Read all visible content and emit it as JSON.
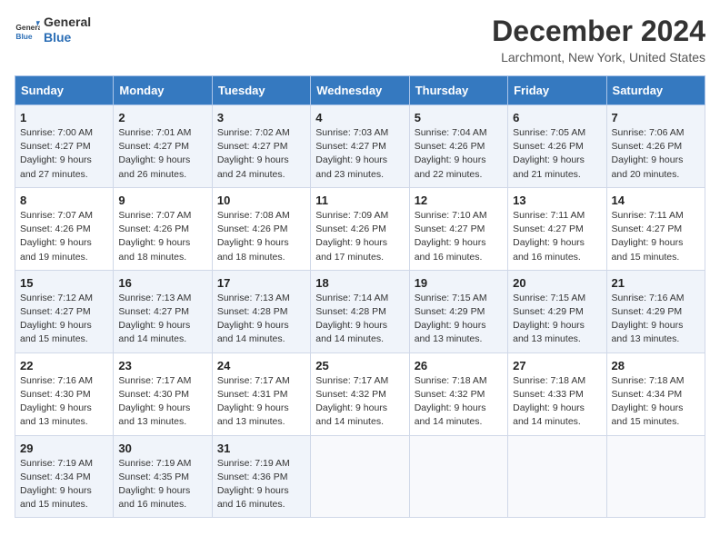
{
  "header": {
    "logo_general": "General",
    "logo_blue": "Blue",
    "title": "December 2024",
    "subtitle": "Larchmont, New York, United States"
  },
  "days_of_week": [
    "Sunday",
    "Monday",
    "Tuesday",
    "Wednesday",
    "Thursday",
    "Friday",
    "Saturday"
  ],
  "weeks": [
    [
      {
        "day": "1",
        "sunrise": "7:00 AM",
        "sunset": "4:27 PM",
        "daylight_hours": "9",
        "daylight_minutes": "27"
      },
      {
        "day": "2",
        "sunrise": "7:01 AM",
        "sunset": "4:27 PM",
        "daylight_hours": "9",
        "daylight_minutes": "26"
      },
      {
        "day": "3",
        "sunrise": "7:02 AM",
        "sunset": "4:27 PM",
        "daylight_hours": "9",
        "daylight_minutes": "24"
      },
      {
        "day": "4",
        "sunrise": "7:03 AM",
        "sunset": "4:27 PM",
        "daylight_hours": "9",
        "daylight_minutes": "23"
      },
      {
        "day": "5",
        "sunrise": "7:04 AM",
        "sunset": "4:26 PM",
        "daylight_hours": "9",
        "daylight_minutes": "22"
      },
      {
        "day": "6",
        "sunrise": "7:05 AM",
        "sunset": "4:26 PM",
        "daylight_hours": "9",
        "daylight_minutes": "21"
      },
      {
        "day": "7",
        "sunrise": "7:06 AM",
        "sunset": "4:26 PM",
        "daylight_hours": "9",
        "daylight_minutes": "20"
      }
    ],
    [
      {
        "day": "8",
        "sunrise": "7:07 AM",
        "sunset": "4:26 PM",
        "daylight_hours": "9",
        "daylight_minutes": "19"
      },
      {
        "day": "9",
        "sunrise": "7:07 AM",
        "sunset": "4:26 PM",
        "daylight_hours": "9",
        "daylight_minutes": "18"
      },
      {
        "day": "10",
        "sunrise": "7:08 AM",
        "sunset": "4:26 PM",
        "daylight_hours": "9",
        "daylight_minutes": "18"
      },
      {
        "day": "11",
        "sunrise": "7:09 AM",
        "sunset": "4:26 PM",
        "daylight_hours": "9",
        "daylight_minutes": "17"
      },
      {
        "day": "12",
        "sunrise": "7:10 AM",
        "sunset": "4:27 PM",
        "daylight_hours": "9",
        "daylight_minutes": "16"
      },
      {
        "day": "13",
        "sunrise": "7:11 AM",
        "sunset": "4:27 PM",
        "daylight_hours": "9",
        "daylight_minutes": "16"
      },
      {
        "day": "14",
        "sunrise": "7:11 AM",
        "sunset": "4:27 PM",
        "daylight_hours": "9",
        "daylight_minutes": "15"
      }
    ],
    [
      {
        "day": "15",
        "sunrise": "7:12 AM",
        "sunset": "4:27 PM",
        "daylight_hours": "9",
        "daylight_minutes": "15"
      },
      {
        "day": "16",
        "sunrise": "7:13 AM",
        "sunset": "4:27 PM",
        "daylight_hours": "9",
        "daylight_minutes": "14"
      },
      {
        "day": "17",
        "sunrise": "7:13 AM",
        "sunset": "4:28 PM",
        "daylight_hours": "9",
        "daylight_minutes": "14"
      },
      {
        "day": "18",
        "sunrise": "7:14 AM",
        "sunset": "4:28 PM",
        "daylight_hours": "9",
        "daylight_minutes": "14"
      },
      {
        "day": "19",
        "sunrise": "7:15 AM",
        "sunset": "4:29 PM",
        "daylight_hours": "9",
        "daylight_minutes": "13"
      },
      {
        "day": "20",
        "sunrise": "7:15 AM",
        "sunset": "4:29 PM",
        "daylight_hours": "9",
        "daylight_minutes": "13"
      },
      {
        "day": "21",
        "sunrise": "7:16 AM",
        "sunset": "4:29 PM",
        "daylight_hours": "9",
        "daylight_minutes": "13"
      }
    ],
    [
      {
        "day": "22",
        "sunrise": "7:16 AM",
        "sunset": "4:30 PM",
        "daylight_hours": "9",
        "daylight_minutes": "13"
      },
      {
        "day": "23",
        "sunrise": "7:17 AM",
        "sunset": "4:30 PM",
        "daylight_hours": "9",
        "daylight_minutes": "13"
      },
      {
        "day": "24",
        "sunrise": "7:17 AM",
        "sunset": "4:31 PM",
        "daylight_hours": "9",
        "daylight_minutes": "13"
      },
      {
        "day": "25",
        "sunrise": "7:17 AM",
        "sunset": "4:32 PM",
        "daylight_hours": "9",
        "daylight_minutes": "14"
      },
      {
        "day": "26",
        "sunrise": "7:18 AM",
        "sunset": "4:32 PM",
        "daylight_hours": "9",
        "daylight_minutes": "14"
      },
      {
        "day": "27",
        "sunrise": "7:18 AM",
        "sunset": "4:33 PM",
        "daylight_hours": "9",
        "daylight_minutes": "14"
      },
      {
        "day": "28",
        "sunrise": "7:18 AM",
        "sunset": "4:34 PM",
        "daylight_hours": "9",
        "daylight_minutes": "15"
      }
    ],
    [
      {
        "day": "29",
        "sunrise": "7:19 AM",
        "sunset": "4:34 PM",
        "daylight_hours": "9",
        "daylight_minutes": "15"
      },
      {
        "day": "30",
        "sunrise": "7:19 AM",
        "sunset": "4:35 PM",
        "daylight_hours": "9",
        "daylight_minutes": "16"
      },
      {
        "day": "31",
        "sunrise": "7:19 AM",
        "sunset": "4:36 PM",
        "daylight_hours": "9",
        "daylight_minutes": "16"
      },
      null,
      null,
      null,
      null
    ]
  ],
  "labels": {
    "sunrise": "Sunrise:",
    "sunset": "Sunset:",
    "daylight": "Daylight:"
  }
}
